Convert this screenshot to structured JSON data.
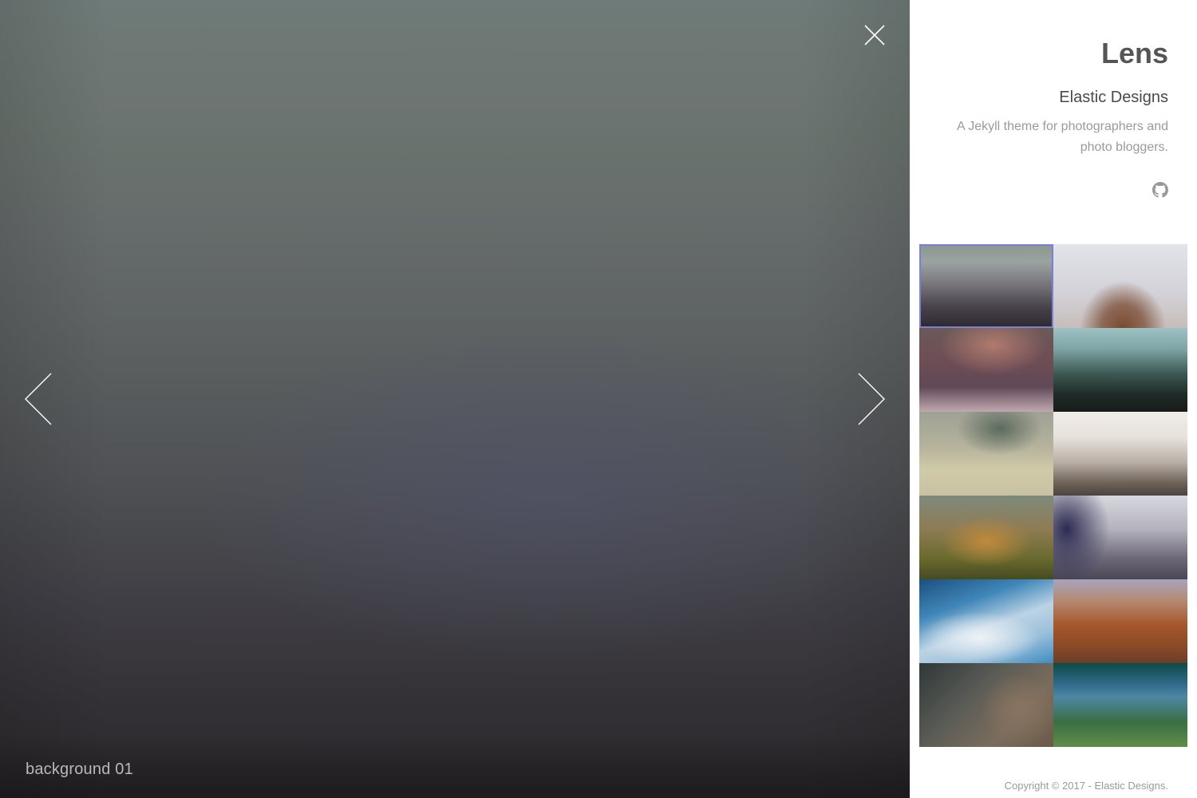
{
  "viewer": {
    "caption": "background 01",
    "controls": {
      "close_icon": "close-icon",
      "prev_icon": "chevron-left-icon",
      "next_icon": "chevron-right-icon"
    }
  },
  "sidebar": {
    "title": "Lens",
    "subtitle": "Elastic Designs",
    "description": "A Jekyll theme for photographers and photo bloggers.",
    "social_icon": "github-icon",
    "thumbnails": {
      "count": 12,
      "active_index": 0,
      "active_border_color": "#7b7fd6"
    },
    "copyright": "Copyright © 2017 - Elastic Designs."
  },
  "colors": {
    "title_text": "#555555",
    "muted_text": "#9a9a9a",
    "caption_text": "#b9b9b9",
    "control_stroke": "#ffffff"
  }
}
